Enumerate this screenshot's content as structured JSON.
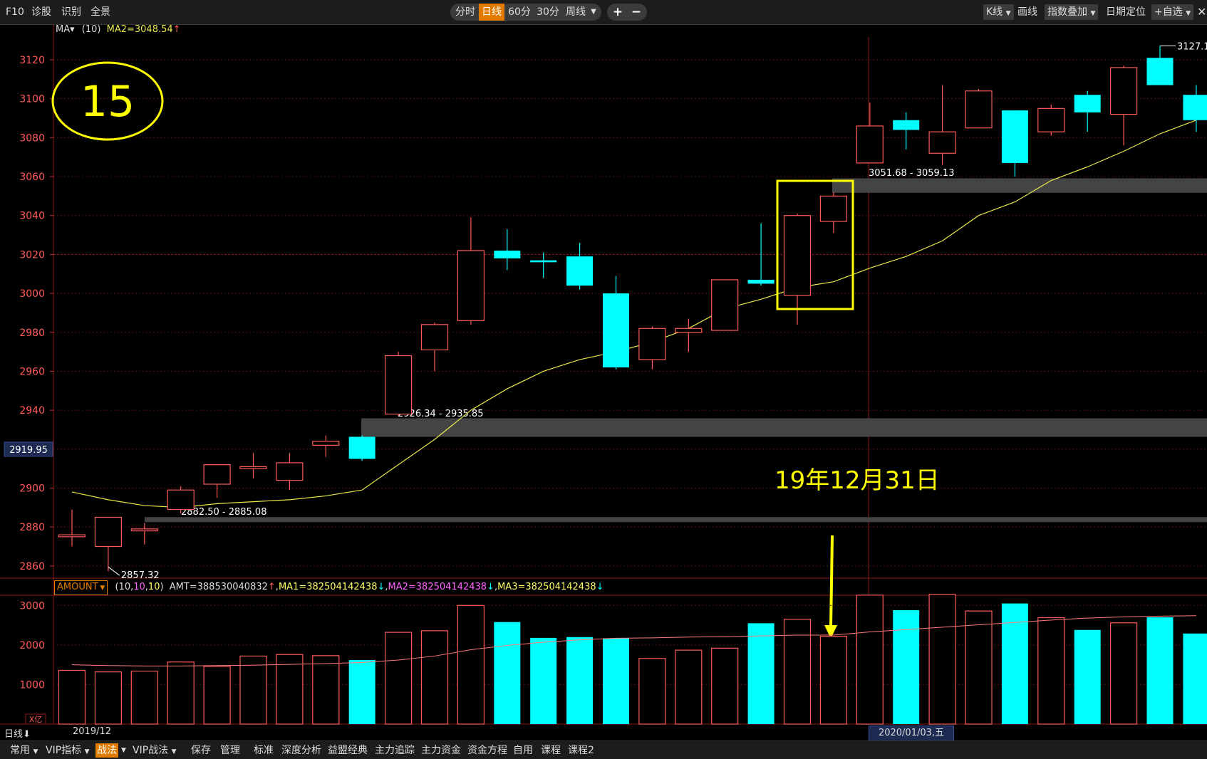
{
  "topbar": {
    "left": [
      "F10",
      "诊股",
      "识别",
      "全景"
    ],
    "periods": [
      "分时",
      "日线",
      "60分",
      "30分",
      "周线"
    ],
    "active_period": "日线",
    "zoom_in": "+",
    "zoom_out": "−",
    "right": [
      "K线",
      "画线",
      "指数叠加",
      "日期定位",
      "+自选"
    ],
    "close": "✕"
  },
  "ma_legend": {
    "ma": "MA▾",
    "params": "(10)",
    "value": "MA2=3048.54",
    "arrow": "↑"
  },
  "price_axis": {
    "ticks": [
      2860,
      2880,
      2900,
      2920,
      2940,
      2960,
      2980,
      3000,
      3020,
      3040,
      3060,
      3080,
      3100,
      3120
    ],
    "current": "2919.95"
  },
  "annotations": {
    "circle_number": "15",
    "date_label": "19年12月31日",
    "gap_labels": [
      "3051.68 - 3059.13",
      "2926.34 - 2935.85",
      "2882.50 - 2885.08"
    ],
    "low_label": "2857.32",
    "high_label": "3127.17"
  },
  "vol_legend": {
    "selector": "AMOUNT",
    "params_open": "(",
    "params": [
      "10",
      "10",
      "10"
    ],
    "params_close": ")",
    "amt": "AMT=388530040832",
    "amt_arrow": "↑",
    "ma1": "MA1=382504142438",
    "ma1_arrow": "↓",
    "ma2": "MA2=382504142438",
    "ma2_arrow": "↓",
    "ma3": "MA3=382504142438",
    "ma3_arrow": "↓",
    "unit": "X亿",
    "ticks": [
      1000,
      2000,
      3000
    ]
  },
  "datebar": {
    "period": "日线",
    "arrow": "⬇",
    "month": "2019/12",
    "cursor_date": "2020/01/03,五"
  },
  "bottombar": [
    "常用",
    "VIP指标",
    "战法",
    "VIP战法",
    "保存",
    "管理",
    "标准",
    "深度分析",
    "益盟经典",
    "主力追踪",
    "主力资金",
    "资金方程",
    "自用",
    "课程",
    "课程2"
  ],
  "bottombar_active": "战法",
  "colors": {
    "up": "#ff5a5a",
    "down": "#00ffff",
    "ma": "#e8e84a",
    "annotation": "#ffff00",
    "gap": "#444444",
    "orange": "#e07b00"
  },
  "chart_data": [
    {
      "type": "candlestick",
      "title": "",
      "ylim": [
        2850,
        3130
      ],
      "candles": [
        {
          "o": 2875,
          "h": 2889,
          "l": 2870,
          "c": 2876
        },
        {
          "o": 2870,
          "h": 2885,
          "l": 2857.32,
          "c": 2885
        },
        {
          "o": 2878,
          "h": 2882,
          "l": 2871,
          "c": 2879
        },
        {
          "o": 2889,
          "h": 2901,
          "l": 2887,
          "c": 2899
        },
        {
          "o": 2902,
          "h": 2912,
          "l": 2895,
          "c": 2912
        },
        {
          "o": 2910,
          "h": 2918,
          "l": 2905,
          "c": 2911
        },
        {
          "o": 2904,
          "h": 2918,
          "l": 2899,
          "c": 2913
        },
        {
          "o": 2922,
          "h": 2927,
          "l": 2916,
          "c": 2924
        },
        {
          "o": 2926.34,
          "h": 2927,
          "l": 2914,
          "c": 2915
        },
        {
          "o": 2938,
          "h": 2970,
          "l": 2937,
          "c": 2968
        },
        {
          "o": 2971,
          "h": 2985,
          "l": 2960,
          "c": 2984
        },
        {
          "o": 2986,
          "h": 3039,
          "l": 2984,
          "c": 3022
        },
        {
          "o": 3022,
          "h": 3033,
          "l": 3012,
          "c": 3018
        },
        {
          "o": 3017,
          "h": 3021,
          "l": 3008,
          "c": 3016
        },
        {
          "o": 3019,
          "h": 3026,
          "l": 3002,
          "c": 3004
        },
        {
          "o": 3000,
          "h": 3009,
          "l": 2961,
          "c": 2962
        },
        {
          "o": 2966,
          "h": 2983,
          "l": 2961,
          "c": 2982
        },
        {
          "o": 2980,
          "h": 2987,
          "l": 2970,
          "c": 2982
        },
        {
          "o": 2981,
          "h": 3007,
          "l": 2981,
          "c": 3007
        },
        {
          "o": 3007,
          "h": 3036,
          "l": 3004,
          "c": 3005
        },
        {
          "o": 2999,
          "h": 3041,
          "l": 2984,
          "c": 3040
        },
        {
          "o": 3037,
          "h": 3052,
          "l": 3031,
          "c": 3050
        },
        {
          "o": 3067,
          "h": 3098,
          "l": 3067,
          "c": 3086
        },
        {
          "o": 3089,
          "h": 3093,
          "l": 3074,
          "c": 3084
        },
        {
          "o": 3072,
          "h": 3107,
          "l": 3066,
          "c": 3083
        },
        {
          "o": 3085,
          "h": 3105,
          "l": 3085,
          "c": 3104
        },
        {
          "o": 3094,
          "h": 3094,
          "l": 3060,
          "c": 3067
        },
        {
          "o": 3083,
          "h": 3097,
          "l": 3081,
          "c": 3095
        },
        {
          "o": 3102,
          "h": 3104,
          "l": 3083,
          "c": 3093
        },
        {
          "o": 3092,
          "h": 3117,
          "l": 3076,
          "c": 3116
        },
        {
          "o": 3121,
          "h": 3127.17,
          "l": 3107,
          "c": 3107
        },
        {
          "o": 3102,
          "h": 3107,
          "l": 3083,
          "c": 3089
        }
      ],
      "ma10": [
        2898,
        2894,
        2891,
        2890,
        2892,
        2893,
        2894,
        2896,
        2899,
        2912,
        2925,
        2940,
        2951,
        2960,
        2966,
        2970,
        2975,
        2982,
        2992,
        2997,
        3003,
        3006,
        3013,
        3019,
        3027,
        3040,
        3047,
        3058,
        3065,
        3073,
        3082,
        3089
      ]
    },
    {
      "type": "bar",
      "title": "AMOUNT",
      "ylim": [
        0,
        3100
      ],
      "values": [
        1360,
        1320,
        1340,
        1570,
        1460,
        1720,
        1760,
        1730,
        1620,
        2320,
        2360,
        3000,
        2580,
        2180,
        2200,
        2170,
        1660,
        1870,
        1920,
        2550,
        2650,
        2220,
        3260,
        2880,
        3280,
        2860,
        3050,
        2690,
        2380,
        2560,
        2700,
        2290
      ],
      "ma": [
        1500,
        1480,
        1470,
        1470,
        1480,
        1490,
        1510,
        1530,
        1560,
        1620,
        1720,
        1880,
        1990,
        2070,
        2130,
        2170,
        2180,
        2200,
        2210,
        2230,
        2250,
        2250,
        2330,
        2390,
        2450,
        2510,
        2570,
        2630,
        2680,
        2710,
        2730,
        2740
      ]
    }
  ]
}
